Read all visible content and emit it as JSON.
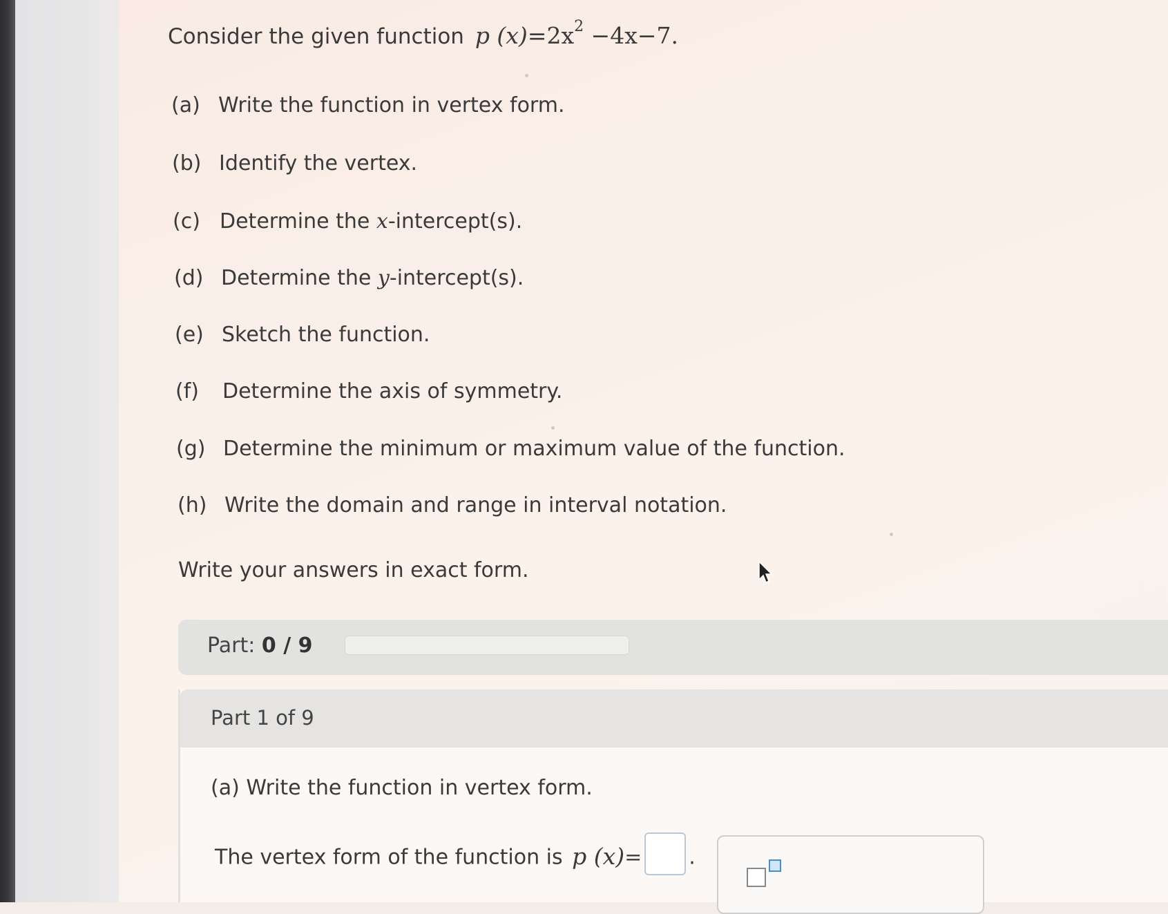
{
  "problem": {
    "intro_text": "Consider the given function",
    "function_lhs": "p (x)",
    "function_eq": "=2x",
    "function_exp": "2",
    "function_tail": " −4x−7.",
    "parts": [
      {
        "label": "(a)",
        "pre": "Write the function in vertex form.",
        "var": "",
        "post": ""
      },
      {
        "label": "(b)",
        "pre": "Identify the vertex.",
        "var": "",
        "post": ""
      },
      {
        "label": "(c)",
        "pre": "Determine the ",
        "var": "x",
        "post": "-intercept(s)."
      },
      {
        "label": "(d)",
        "pre": "Determine the ",
        "var": "y",
        "post": "-intercept(s)."
      },
      {
        "label": "(e)",
        "pre": "Sketch the function.",
        "var": "",
        "post": ""
      },
      {
        "label": "(f)",
        "pre": "Determine the axis of symmetry.",
        "var": "",
        "post": ""
      },
      {
        "label": "(g)",
        "pre": "Determine the minimum or maximum value of the function.",
        "var": "",
        "post": ""
      },
      {
        "label": "(h)",
        "pre": "Write the domain and range in interval notation.",
        "var": "",
        "post": ""
      }
    ],
    "instruction": "Write your answers in exact form."
  },
  "progress": {
    "label": "Part:",
    "score": "0 / 9",
    "completed_fraction": 0
  },
  "current_part": {
    "header": "Part 1 of 9",
    "question": "(a) Write the function in vertex form.",
    "answer_prefix": "The vertex form of the function is",
    "answer_fn": "p (x)",
    "answer_eq": "=",
    "answer_suffix": ".",
    "toolbox_icon": "superscript-template-icon"
  },
  "colors": {
    "accent": "#7bb0e0",
    "input_border": "#b8c8d6"
  }
}
